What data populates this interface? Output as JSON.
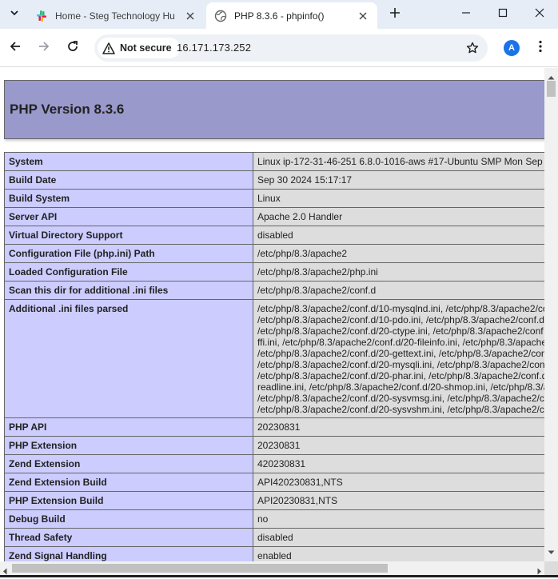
{
  "browser": {
    "tabs": [
      {
        "title": "Home - Steg Technology Hu",
        "active": false,
        "favicon": "slack-icon"
      },
      {
        "title": "PHP 8.3.6 - phpinfo()",
        "active": true,
        "favicon": "globe-icon"
      }
    ],
    "security_label": "Not secure",
    "url": "16.171.173.252",
    "avatar_letter": "A",
    "colors": {
      "tabstrip": "#e6edf7",
      "omnibox": "#eef1f6",
      "avatar": "#1a73e8"
    }
  },
  "page": {
    "heading": "PHP Version 8.3.6",
    "rows": [
      {
        "key": "System",
        "value": [
          "Linux ip-172-31-46-251 6.8.0-1016-aws #17-Ubuntu SMP Mon Sep"
        ]
      },
      {
        "key": "Build Date",
        "value": [
          "Sep 30 2024 15:17:17"
        ]
      },
      {
        "key": "Build System",
        "value": [
          "Linux"
        ]
      },
      {
        "key": "Server API",
        "value": [
          "Apache 2.0 Handler"
        ]
      },
      {
        "key": "Virtual Directory Support",
        "value": [
          "disabled"
        ]
      },
      {
        "key": "Configuration File (php.ini) Path",
        "value": [
          "/etc/php/8.3/apache2"
        ]
      },
      {
        "key": "Loaded Configuration File",
        "value": [
          "/etc/php/8.3/apache2/php.ini"
        ]
      },
      {
        "key": "Scan this dir for additional .ini files",
        "value": [
          "/etc/php/8.3/apache2/conf.d"
        ]
      },
      {
        "key": "Additional .ini files parsed",
        "value": [
          "/etc/php/8.3/apache2/conf.d/10-mysqlnd.ini, /etc/php/8.3/apache2/co",
          "/etc/php/8.3/apache2/conf.d/10-pdo.ini, /etc/php/8.3/apache2/conf.d",
          "/etc/php/8.3/apache2/conf.d/20-ctype.ini, /etc/php/8.3/apache2/conf",
          "ffi.ini, /etc/php/8.3/apache2/conf.d/20-fileinfo.ini, /etc/php/8.3/apache",
          "/etc/php/8.3/apache2/conf.d/20-gettext.ini, /etc/php/8.3/apache2/conf",
          "/etc/php/8.3/apache2/conf.d/20-mysqli.ini, /etc/php/8.3/apache2/con",
          "/etc/php/8.3/apache2/conf.d/20-phar.ini, /etc/php/8.3/apache2/conf.d",
          "readline.ini, /etc/php/8.3/apache2/conf.d/20-shmop.ini, /etc/php/8.3/a",
          "/etc/php/8.3/apache2/conf.d/20-sysvmsg.ini, /etc/php/8.3/apache2/c",
          "/etc/php/8.3/apache2/conf.d/20-sysvshm.ini, /etc/php/8.3/apache2/c"
        ]
      },
      {
        "key": "PHP API",
        "value": [
          "20230831"
        ]
      },
      {
        "key": "PHP Extension",
        "value": [
          "20230831"
        ]
      },
      {
        "key": "Zend Extension",
        "value": [
          "420230831"
        ]
      },
      {
        "key": "Zend Extension Build",
        "value": [
          "API420230831,NTS"
        ]
      },
      {
        "key": "PHP Extension Build",
        "value": [
          "API20230831,NTS"
        ]
      },
      {
        "key": "Debug Build",
        "value": [
          "no"
        ]
      },
      {
        "key": "Thread Safety",
        "value": [
          "disabled"
        ]
      },
      {
        "key": "Zend Signal Handling",
        "value": [
          "enabled"
        ]
      }
    ],
    "colors": {
      "header": "#9999cc",
      "key_cell": "#ccccff",
      "value_cell": "#dddddd"
    }
  }
}
